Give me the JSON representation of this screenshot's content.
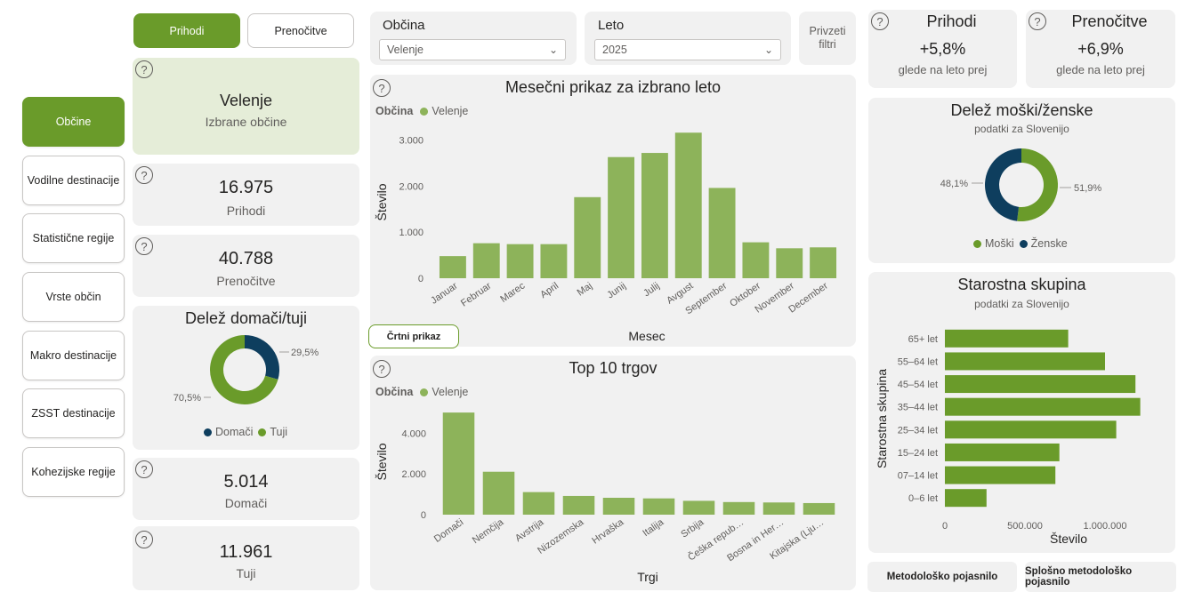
{
  "toggle": {
    "left_label": "Prihodi",
    "right_label": "Prenočitve"
  },
  "nav": [
    {
      "label": "Občine",
      "active": true
    },
    {
      "label": "Vodilne destinacije"
    },
    {
      "label": "Statistične regije"
    },
    {
      "label": "Vrste občin"
    },
    {
      "label": "Makro destinacije"
    },
    {
      "label": "ZSST destinacije"
    },
    {
      "label": "Kohezijske regije"
    }
  ],
  "help_glyph": "?",
  "selected": {
    "name": "Velenje",
    "caption": "Izbrane občine"
  },
  "kpis": {
    "prihodi": {
      "value": "16.975",
      "label": "Prihodi"
    },
    "prenocitve": {
      "value": "40.788",
      "label": "Prenočitve"
    },
    "domaci": {
      "value": "5.014",
      "label": "Domači"
    },
    "tuji": {
      "value": "11.961",
      "label": "Tuji"
    }
  },
  "filters": {
    "obcina": {
      "label": "Občina",
      "value": "Velenje"
    },
    "leto": {
      "label": "Leto",
      "value": "2025"
    },
    "reset_label_1": "Privzeti",
    "reset_label_2": "filtri"
  },
  "changes": {
    "prihodi": {
      "title": "Prihodi",
      "value": "+5,8%",
      "caption": "glede na leto prej"
    },
    "prenocitve": {
      "title": "Prenočitve",
      "value": "+6,9%",
      "caption": "glede na leto prej"
    }
  },
  "chart_toggle_label": "Črtni prikaz",
  "footer": {
    "left": "Metodološko pojasnilo",
    "right": "Splošno metodološko pojasnilo"
  },
  "colors": {
    "accent": "#6a9b2a",
    "bar": "#8db35a",
    "dark": "#0e3e5e",
    "card": "#f1f1f1",
    "light_green": "#e5edd8",
    "hbar": "#6a9b2a"
  },
  "chart_data": [
    {
      "type": "bar",
      "title": "Mesečni prikaz za izbrano leto",
      "legend_title": "Občina",
      "legend_placement": "top-left",
      "series": [
        {
          "name": "Velenje",
          "values": [
            480,
            760,
            740,
            740,
            1760,
            2630,
            2720,
            3160,
            1960,
            780,
            650,
            670
          ]
        }
      ],
      "categories": [
        "Januar",
        "Februar",
        "Marec",
        "April",
        "Maj",
        "Junij",
        "Julij",
        "Avgust",
        "September",
        "Oktober",
        "November",
        "December"
      ],
      "ticks": [
        "0",
        "1.000",
        "2.000",
        "3.000"
      ],
      "xlabel": "Mesec",
      "ylabel": "Število",
      "ylim": [
        0,
        3300
      ],
      "grid": false
    },
    {
      "type": "bar",
      "title": "Top 10 trgov",
      "legend_title": "Občina",
      "legend_placement": "top-left",
      "series": [
        {
          "name": "Velenje",
          "values": [
            5020,
            2110,
            1110,
            920,
            830,
            800,
            680,
            620,
            600,
            570
          ]
        }
      ],
      "categories": [
        "Domači",
        "Nemčija",
        "Avstrija",
        "Nizozemska",
        "Hrvaška",
        "Italija",
        "Srbija",
        "Češka repub…",
        "Bosna in Her…",
        "Kitajska (Lju…"
      ],
      "ticks": [
        "0",
        "2.000",
        "4.000"
      ],
      "xlabel": "Trgi",
      "ylabel": "Število",
      "ylim": [
        0,
        5200
      ],
      "grid": false
    },
    {
      "type": "pie",
      "title": "Delež domači/tuji",
      "categories": [
        "Domači",
        "Tuji"
      ],
      "values": [
        29.5,
        70.5
      ],
      "labels": [
        "29,5%",
        "70,5%"
      ],
      "legend_placement": "bottom"
    },
    {
      "type": "pie",
      "title": "Delež moški/ženske",
      "subtitle": "podatki za Slovenijo",
      "categories": [
        "Moški",
        "Ženske"
      ],
      "values": [
        51.9,
        48.1
      ],
      "labels": [
        "51,9%",
        "48,1%"
      ],
      "legend_placement": "bottom"
    },
    {
      "type": "bar",
      "orientation": "horizontal",
      "title": "Starostna skupina",
      "subtitle": "podatki za Slovenijo",
      "categories": [
        "65+ let",
        "55–64 let",
        "45–54 let",
        "35–44 let",
        "25–34 let",
        "15–24 let",
        "07–14 let",
        "0–6 let"
      ],
      "values": [
        770000,
        1000000,
        1190000,
        1220000,
        1070000,
        715000,
        690000,
        260000
      ],
      "ticks": [
        "0",
        "500.000",
        "1.000.000"
      ],
      "xlabel": "Število",
      "ylabel": "Starostna skupina",
      "xlim": [
        0,
        1300000
      ],
      "grid": false
    }
  ]
}
